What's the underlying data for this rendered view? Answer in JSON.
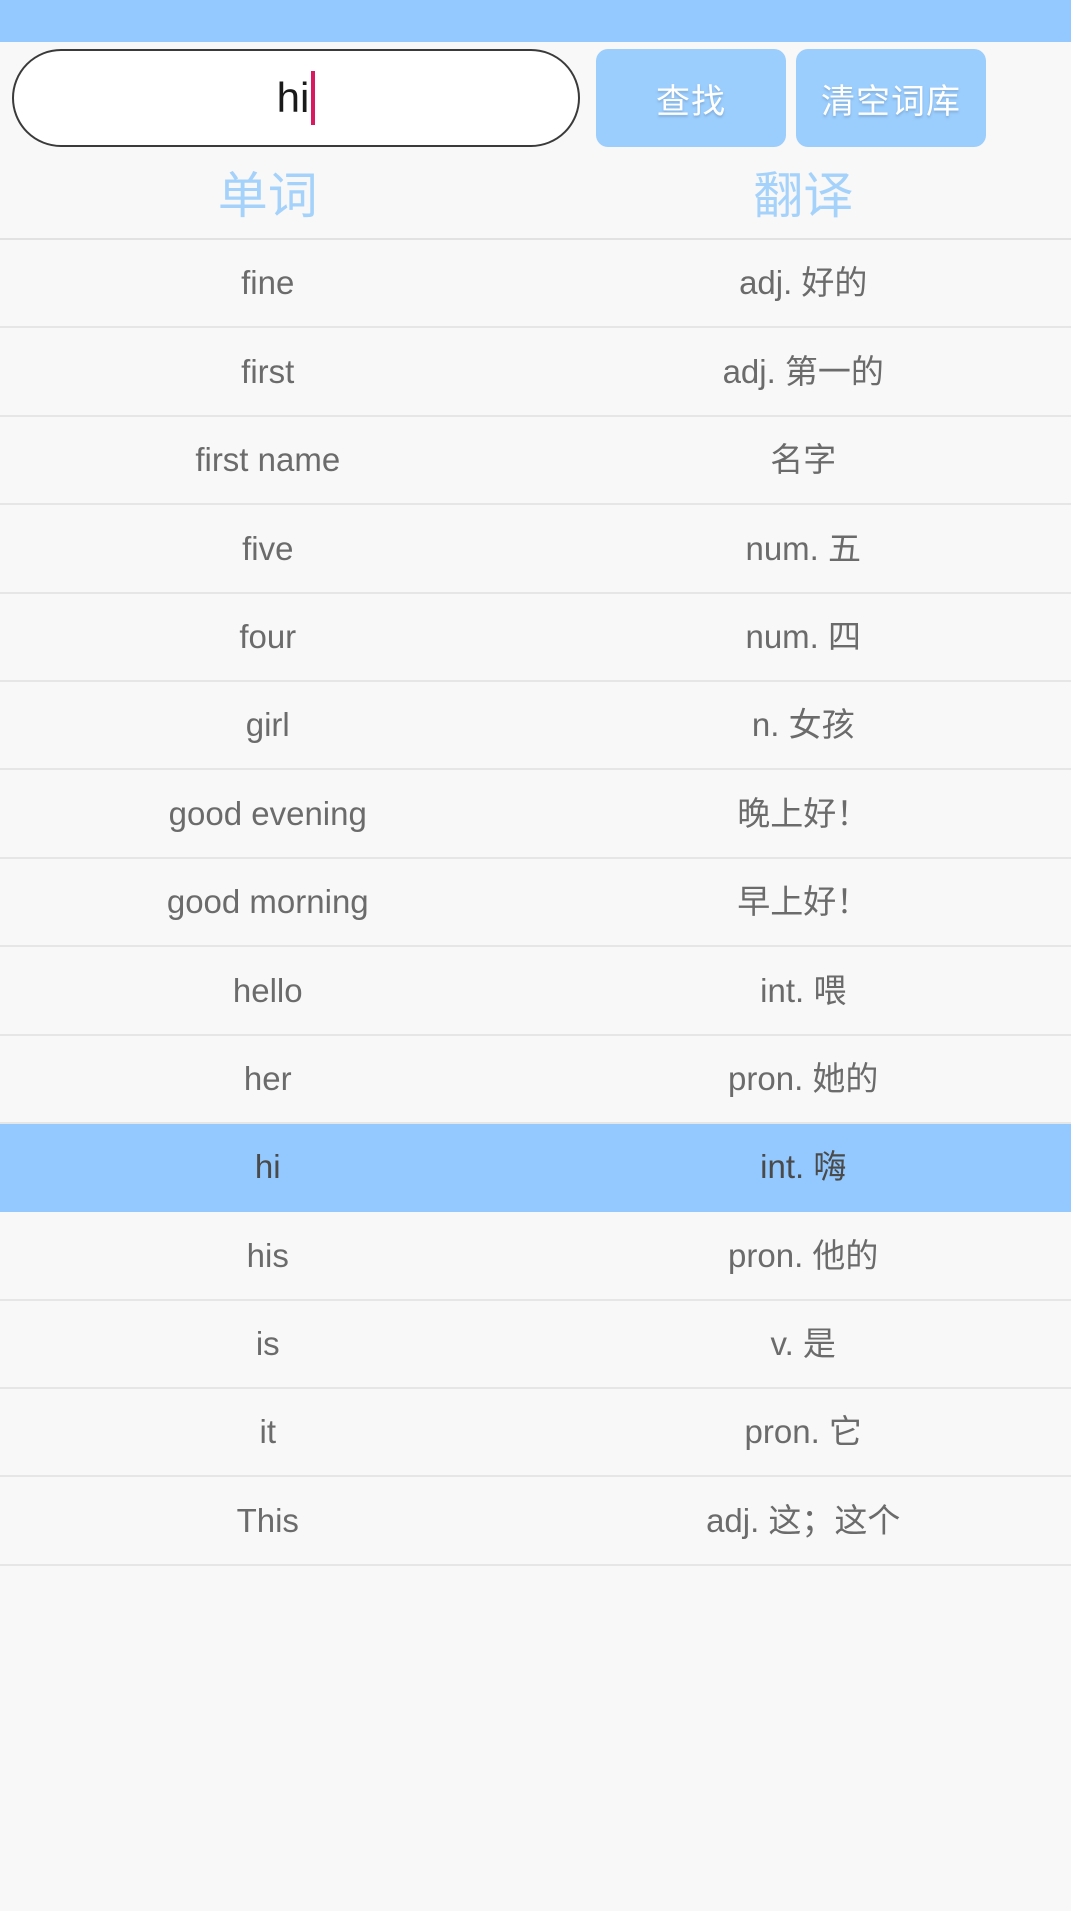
{
  "theme": {
    "status_bar_color": "#93c9ff",
    "accent_color": "#9bcdfd",
    "header_text_color": "#a5d2fb",
    "selected_row_color": "#93c9ff",
    "page_background": "#f8f8f8",
    "caret_color": "#d81b60"
  },
  "search": {
    "value": "hi",
    "placeholder": "",
    "find_button_label": "查找",
    "clear_button_label": "清空词库"
  },
  "table": {
    "headers": {
      "word": "单词",
      "translation": "翻译"
    },
    "selected_word": "hi",
    "rows": [
      {
        "word": "fine",
        "translation": "adj. 好的"
      },
      {
        "word": "first",
        "translation": "adj. 第一的"
      },
      {
        "word": "first name",
        "translation": "名字"
      },
      {
        "word": "five",
        "translation": "num. 五"
      },
      {
        "word": "four",
        "translation": "num. 四"
      },
      {
        "word": "girl",
        "translation": "n. 女孩"
      },
      {
        "word": "good evening",
        "translation": "晚上好！"
      },
      {
        "word": "good morning",
        "translation": "早上好！"
      },
      {
        "word": "hello",
        "translation": "int. 喂"
      },
      {
        "word": "her",
        "translation": "pron. 她的"
      },
      {
        "word": "hi",
        "translation": "int. 嗨"
      },
      {
        "word": "his",
        "translation": "pron. 他的"
      },
      {
        "word": "is",
        "translation": "v. 是"
      },
      {
        "word": "it",
        "translation": "pron. 它"
      },
      {
        "word": "This",
        "translation": "adj. 这；这个"
      }
    ]
  }
}
